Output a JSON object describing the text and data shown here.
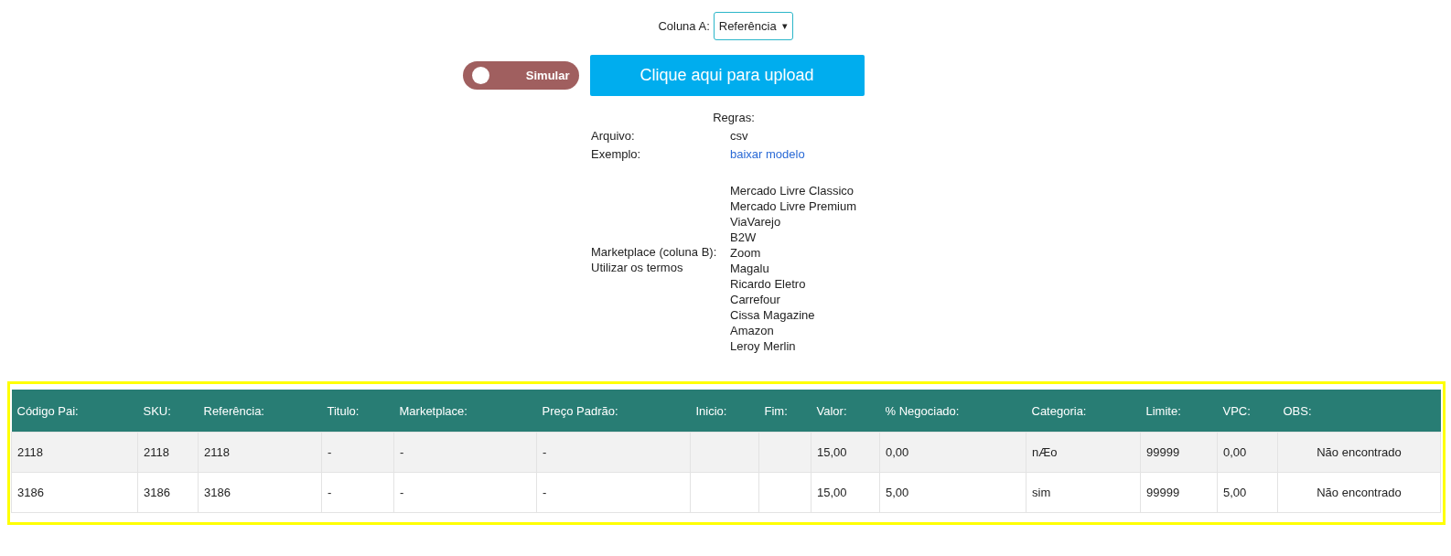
{
  "column_a": {
    "label": "Coluna A:",
    "value": "Referência",
    "caret": "▾"
  },
  "simulate_toggle": {
    "label": "Simular",
    "on": false
  },
  "upload_button": {
    "label": "Clique aqui para upload"
  },
  "rules": {
    "title": "Regras:",
    "items": [
      {
        "kind": "text",
        "label": "Arquivo:",
        "values": [
          "csv"
        ]
      },
      {
        "kind": "link",
        "label": "Exemplo:",
        "values": [
          "baixar modelo"
        ]
      },
      {
        "kind": "list",
        "label": "Marketplace (coluna B):",
        "note": "Utilizar os termos",
        "values": [
          "Mercado Livre Classico",
          "Mercado Livre Premium",
          "ViaVarejo",
          "B2W",
          "Zoom",
          "Magalu",
          "Ricardo Eletro",
          "Carrefour",
          "Cissa Magazine",
          "Amazon",
          "Leroy Merlin"
        ]
      }
    ]
  },
  "table": {
    "columns": [
      "Código Pai:",
      "SKU:",
      "Referência:",
      "Titulo:",
      "Marketplace:",
      "Preço Padrão:",
      "Inicio:",
      "Fim:",
      "Valor:",
      "% Negociado:",
      "Categoria:",
      "Limite:",
      "VPC:",
      "OBS:"
    ],
    "rows": [
      [
        "2118",
        "2118",
        "2118",
        "-",
        "-",
        "-",
        "",
        "",
        "15,00",
        "0,00",
        "nÆo",
        "99999",
        "0,00",
        "Não encontrado"
      ],
      [
        "3186",
        "3186",
        "3186",
        "-",
        "-",
        "-",
        "",
        "",
        "15,00",
        "5,00",
        "sim",
        "99999",
        "5,00",
        "Não encontrado"
      ]
    ]
  }
}
